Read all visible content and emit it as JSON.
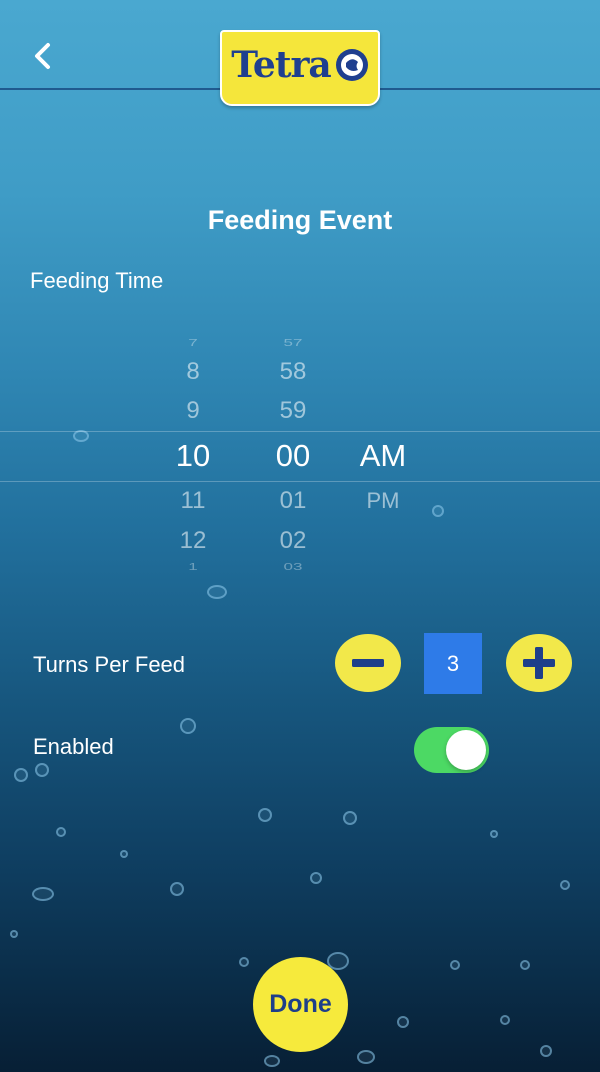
{
  "header": {
    "back_icon": "chevron-left-icon",
    "logo_text": "Tetra"
  },
  "page": {
    "title": "Feeding Event"
  },
  "feeding_time": {
    "label": "Feeding Time",
    "hours": [
      "7",
      "8",
      "9",
      "10",
      "11",
      "12",
      "1"
    ],
    "minutes": [
      "57",
      "58",
      "59",
      "00",
      "01",
      "02",
      "03"
    ],
    "periods": [
      "AM",
      "PM"
    ],
    "selected": {
      "hour": "10",
      "minute": "00",
      "period": "AM"
    }
  },
  "turns": {
    "label": "Turns Per Feed",
    "value": "3",
    "decrement_icon": "minus-icon",
    "increment_icon": "plus-icon"
  },
  "enabled": {
    "label": "Enabled",
    "on": true
  },
  "done": {
    "label": "Done"
  },
  "colors": {
    "accent_yellow": "#f2e84a",
    "stepper_blue": "#2e7be8",
    "toggle_green": "#4cd964",
    "brand_blue": "#1e3f8a"
  }
}
